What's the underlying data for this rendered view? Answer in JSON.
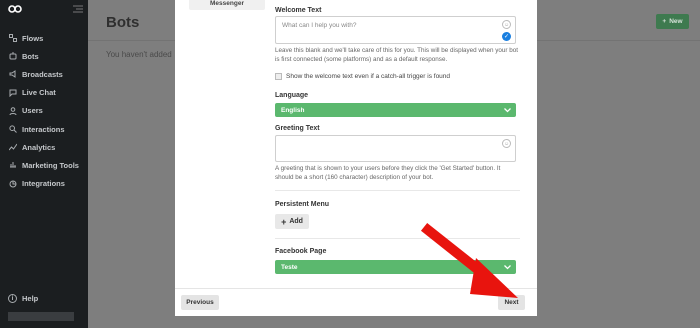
{
  "colors": {
    "sidebar_bg": "#1b1e20",
    "accent_green": "#5bb86e",
    "checked_blue": "#1a7fe0",
    "arrow_red": "#e8140e"
  },
  "sidebar": {
    "items": [
      {
        "label": "Flows",
        "icon": "flows-icon"
      },
      {
        "label": "Bots",
        "icon": "bots-icon"
      },
      {
        "label": "Broadcasts",
        "icon": "broadcast-icon"
      },
      {
        "label": "Live Chat",
        "icon": "chat-icon"
      },
      {
        "label": "Users",
        "icon": "users-icon"
      },
      {
        "label": "Interactions",
        "icon": "search-icon"
      },
      {
        "label": "Analytics",
        "icon": "analytics-icon"
      },
      {
        "label": "Marketing Tools",
        "icon": "marketing-icon"
      },
      {
        "label": "Integrations",
        "icon": "integrations-icon"
      }
    ],
    "help_label": "Help"
  },
  "main": {
    "title": "Bots",
    "new_button": "New",
    "empty_message": "You haven't added"
  },
  "modal": {
    "tab_label": "Messenger",
    "welcome": {
      "label": "Welcome Text",
      "placeholder": "What can I help you with?",
      "help": "Leave this blank and we'll take care of this for you. This will be displayed when your bot is first connected (some platforms) and as a default response."
    },
    "checkbox_label": "Show the welcome text even if a catch-all trigger is found",
    "language": {
      "label": "Language",
      "value": "English"
    },
    "greeting": {
      "label": "Greeting Text",
      "help": "A greeting that is shown to your users before they click the 'Get Started' button. It should be a short (160 character) description of your bot."
    },
    "persistent_menu": {
      "label": "Persistent Menu",
      "add_button": "Add"
    },
    "facebook_page": {
      "label": "Facebook Page",
      "value": "Teste"
    },
    "previous_button": "Previous",
    "next_button": "Next"
  }
}
